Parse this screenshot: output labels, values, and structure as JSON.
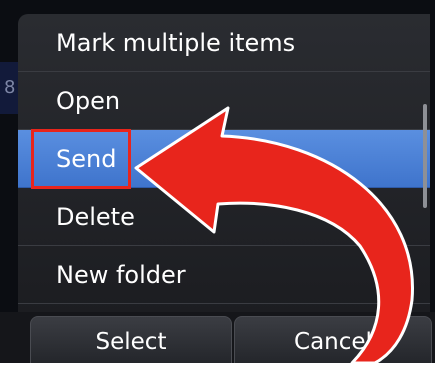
{
  "background_peek_text": "8",
  "menu": {
    "items": [
      {
        "label": "Mark multiple items"
      },
      {
        "label": "Open"
      },
      {
        "label": "Send",
        "selected": true
      },
      {
        "label": "Delete"
      },
      {
        "label": "New folder"
      }
    ]
  },
  "softkeys": {
    "left_label": "Select",
    "right_label": "Cancel"
  },
  "annotation": {
    "arrow_icon": "curved-arrow-icon",
    "color": "#e8251c"
  },
  "colors": {
    "menu_background": "#2a2c31",
    "selection": "#4a82d8",
    "highlight": "#e8251c"
  }
}
